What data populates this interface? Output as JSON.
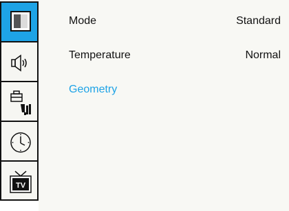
{
  "sidebar": {
    "items": [
      {
        "name": "picture",
        "icon": "picture-icon",
        "active": true
      },
      {
        "name": "sound",
        "icon": "speaker-icon",
        "active": false
      },
      {
        "name": "setup",
        "icon": "toolbox-icon",
        "active": false
      },
      {
        "name": "time",
        "icon": "clock-icon",
        "active": false
      },
      {
        "name": "tv",
        "icon": "tv-icon",
        "active": false
      }
    ]
  },
  "menu": {
    "rows": [
      {
        "label": "Mode",
        "value": "Standard"
      },
      {
        "label": "Temperature",
        "value": "Normal"
      },
      {
        "label": "Geometry",
        "value": ""
      }
    ]
  },
  "colors": {
    "accent": "#1ea3e6",
    "text": "#111111",
    "background": "#f8f8f4"
  }
}
